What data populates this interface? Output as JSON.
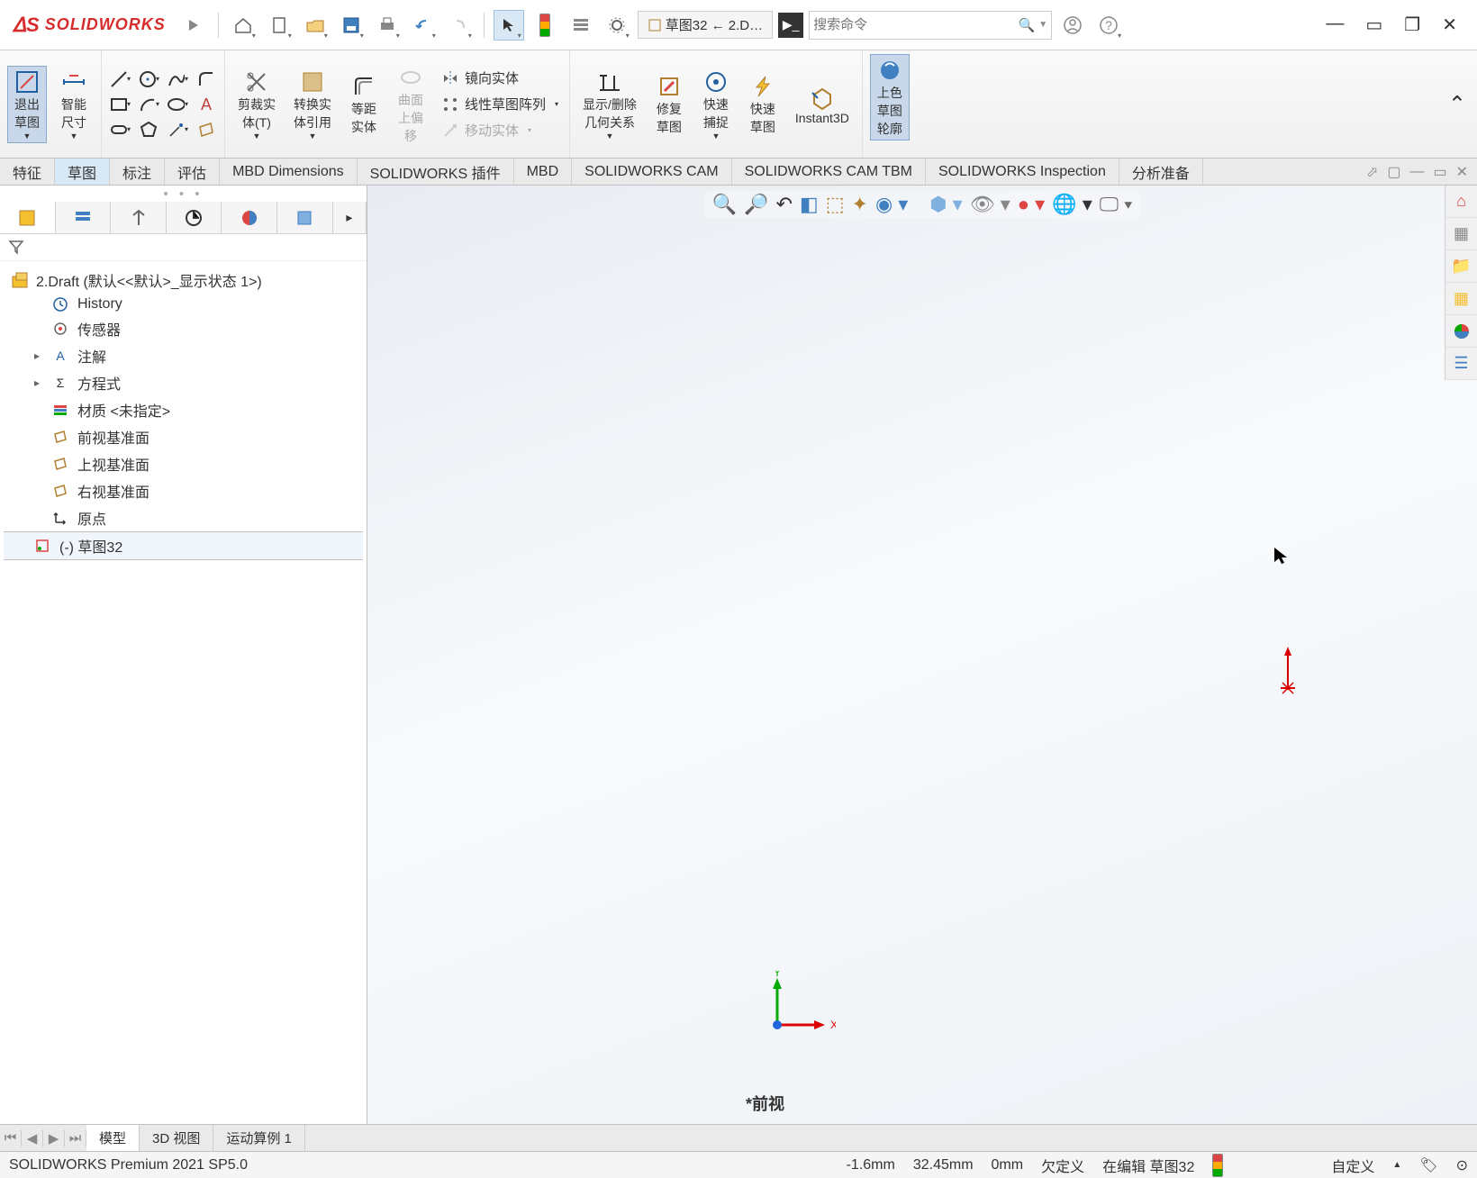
{
  "app": {
    "name": "SOLIDWORKS"
  },
  "titlebar": {
    "doc_tab": "草图32 ← 2.D…",
    "search_placeholder": "搜索命令"
  },
  "ribbon": {
    "exit_sketch": "退出\n草图",
    "smart_dim": "智能\n尺寸",
    "trim": "剪裁实\n体(T)",
    "convert": "转换实\n体引用",
    "offset": "等距\n实体",
    "surface_offset": "曲面\n上偏\n移",
    "mirror": "镜向实体",
    "linear_pattern": "线性草图阵列",
    "move": "移动实体",
    "display_delete": "显示/删除\n几何关系",
    "repair": "修复\n草图",
    "quick_snap": "快速\n捕捉",
    "rapid_sketch": "快速\n草图",
    "instant3d": "Instant3D",
    "shaded": "上色\n草图\n轮廓"
  },
  "tabs": {
    "items": [
      "特征",
      "草图",
      "标注",
      "评估",
      "MBD Dimensions",
      "SOLIDWORKS 插件",
      "MBD",
      "SOLIDWORKS CAM",
      "SOLIDWORKS CAM TBM",
      "SOLIDWORKS Inspection",
      "分析准备"
    ],
    "active_index": 1
  },
  "tree": {
    "root": "2.Draft  (默认<<默认>_显示状态 1>)",
    "items": [
      {
        "icon": "history",
        "label": "History"
      },
      {
        "icon": "sensor",
        "label": "传感器"
      },
      {
        "icon": "annot",
        "label": "注解",
        "chev": "▸"
      },
      {
        "icon": "eq",
        "label": "方程式",
        "chev": "▸"
      },
      {
        "icon": "mat",
        "label": "材质 <未指定>"
      },
      {
        "icon": "plane",
        "label": "前视基准面"
      },
      {
        "icon": "plane",
        "label": "上视基准面"
      },
      {
        "icon": "plane",
        "label": "右视基准面"
      },
      {
        "icon": "origin",
        "label": "原点"
      },
      {
        "icon": "sketch",
        "label": "(-) 草图32"
      }
    ]
  },
  "viewport": {
    "label": "*前视"
  },
  "bottom_tabs": {
    "items": [
      "模型",
      "3D 视图",
      "运动算例 1"
    ],
    "active_index": 0
  },
  "status": {
    "product": "SOLIDWORKS Premium 2021 SP5.0",
    "x": "-1.6mm",
    "y": "32.45mm",
    "z": "0mm",
    "defn": "欠定义",
    "editing": "在编辑 草图32",
    "custom": "自定义"
  }
}
